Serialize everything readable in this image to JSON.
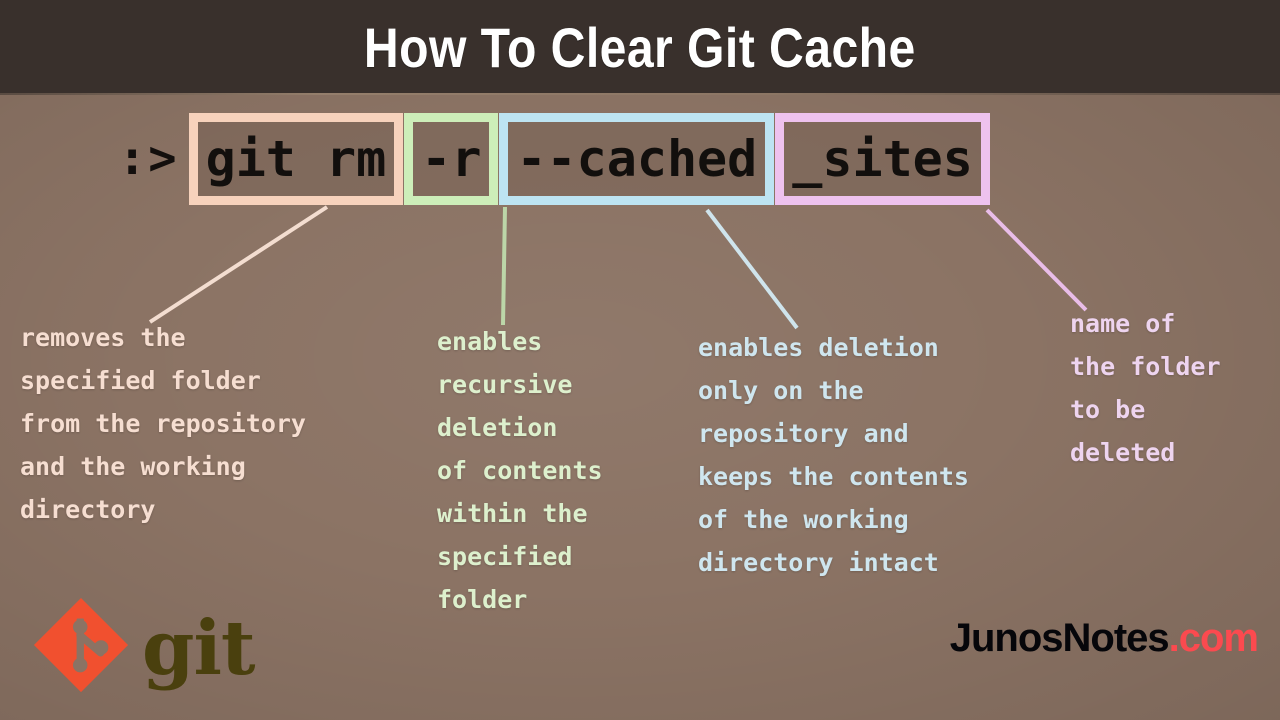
{
  "header": {
    "title": "How To Clear Git Cache",
    "background_color": "#39302c",
    "text_color": "#ffffff"
  },
  "page": {
    "background_color": "#8b7364"
  },
  "command": {
    "prompt": ":>",
    "full_command": "git rm -r --cached _sites",
    "tokens": [
      {
        "text": "git rm",
        "color": "#f7d2bc",
        "name": "git-rm"
      },
      {
        "text": "-r",
        "color": "#cdeeb9",
        "name": "recursive-flag"
      },
      {
        "text": "--cached",
        "color": "#bde4f2",
        "name": "cached-flag"
      },
      {
        "text": "_sites",
        "color": "#eec2ee",
        "name": "folder-arg"
      }
    ]
  },
  "annotations": [
    {
      "text": "removes the\nspecified folder\nfrom the repository\nand the working\ndirectory",
      "color": "#f6ded1"
    },
    {
      "text": "enables\nrecursive\ndeletion\nof contents\nwithin the\nspecified\nfolder",
      "color": "#ddf0cd"
    },
    {
      "text": "enables deletion\nonly on the\nrepository and\nkeeps the contents\nof the working\ndirectory intact",
      "color": "#cfe6ef"
    },
    {
      "text": "name of\nthe folder\nto be\ndeleted",
      "color": "#eed4ef"
    }
  ],
  "footer": {
    "git_logo_word": "git",
    "git_logo_color": "#4a400e",
    "git_mark_color": "#f1502f",
    "brand_name": "JunosNotes",
    "brand_tld": ".com",
    "brand_tld_color": "#fb4a4f"
  }
}
